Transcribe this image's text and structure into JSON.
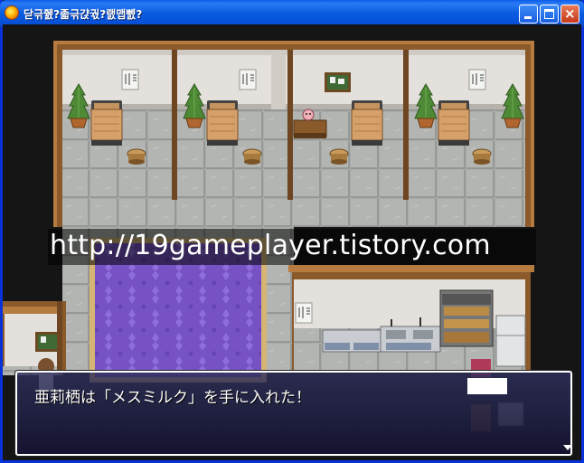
{
  "window": {
    "title": "닫귺쥀?졻귺갽궋?랤맵뻸?",
    "buttons": {
      "minimize": "minimize",
      "maximize": "maximize",
      "close": "×"
    }
  },
  "game": {
    "watermark": "http://19gameplayer.tistory.com",
    "message": "亜莉栖は「メスミルク」を手に入れた！"
  },
  "colors": {
    "titlebar": "#0a5ce0",
    "wall": "#e4e0dc",
    "floor": "#a7aaa6",
    "wood": "#b67b3e",
    "carpet": "#7a57c9"
  }
}
